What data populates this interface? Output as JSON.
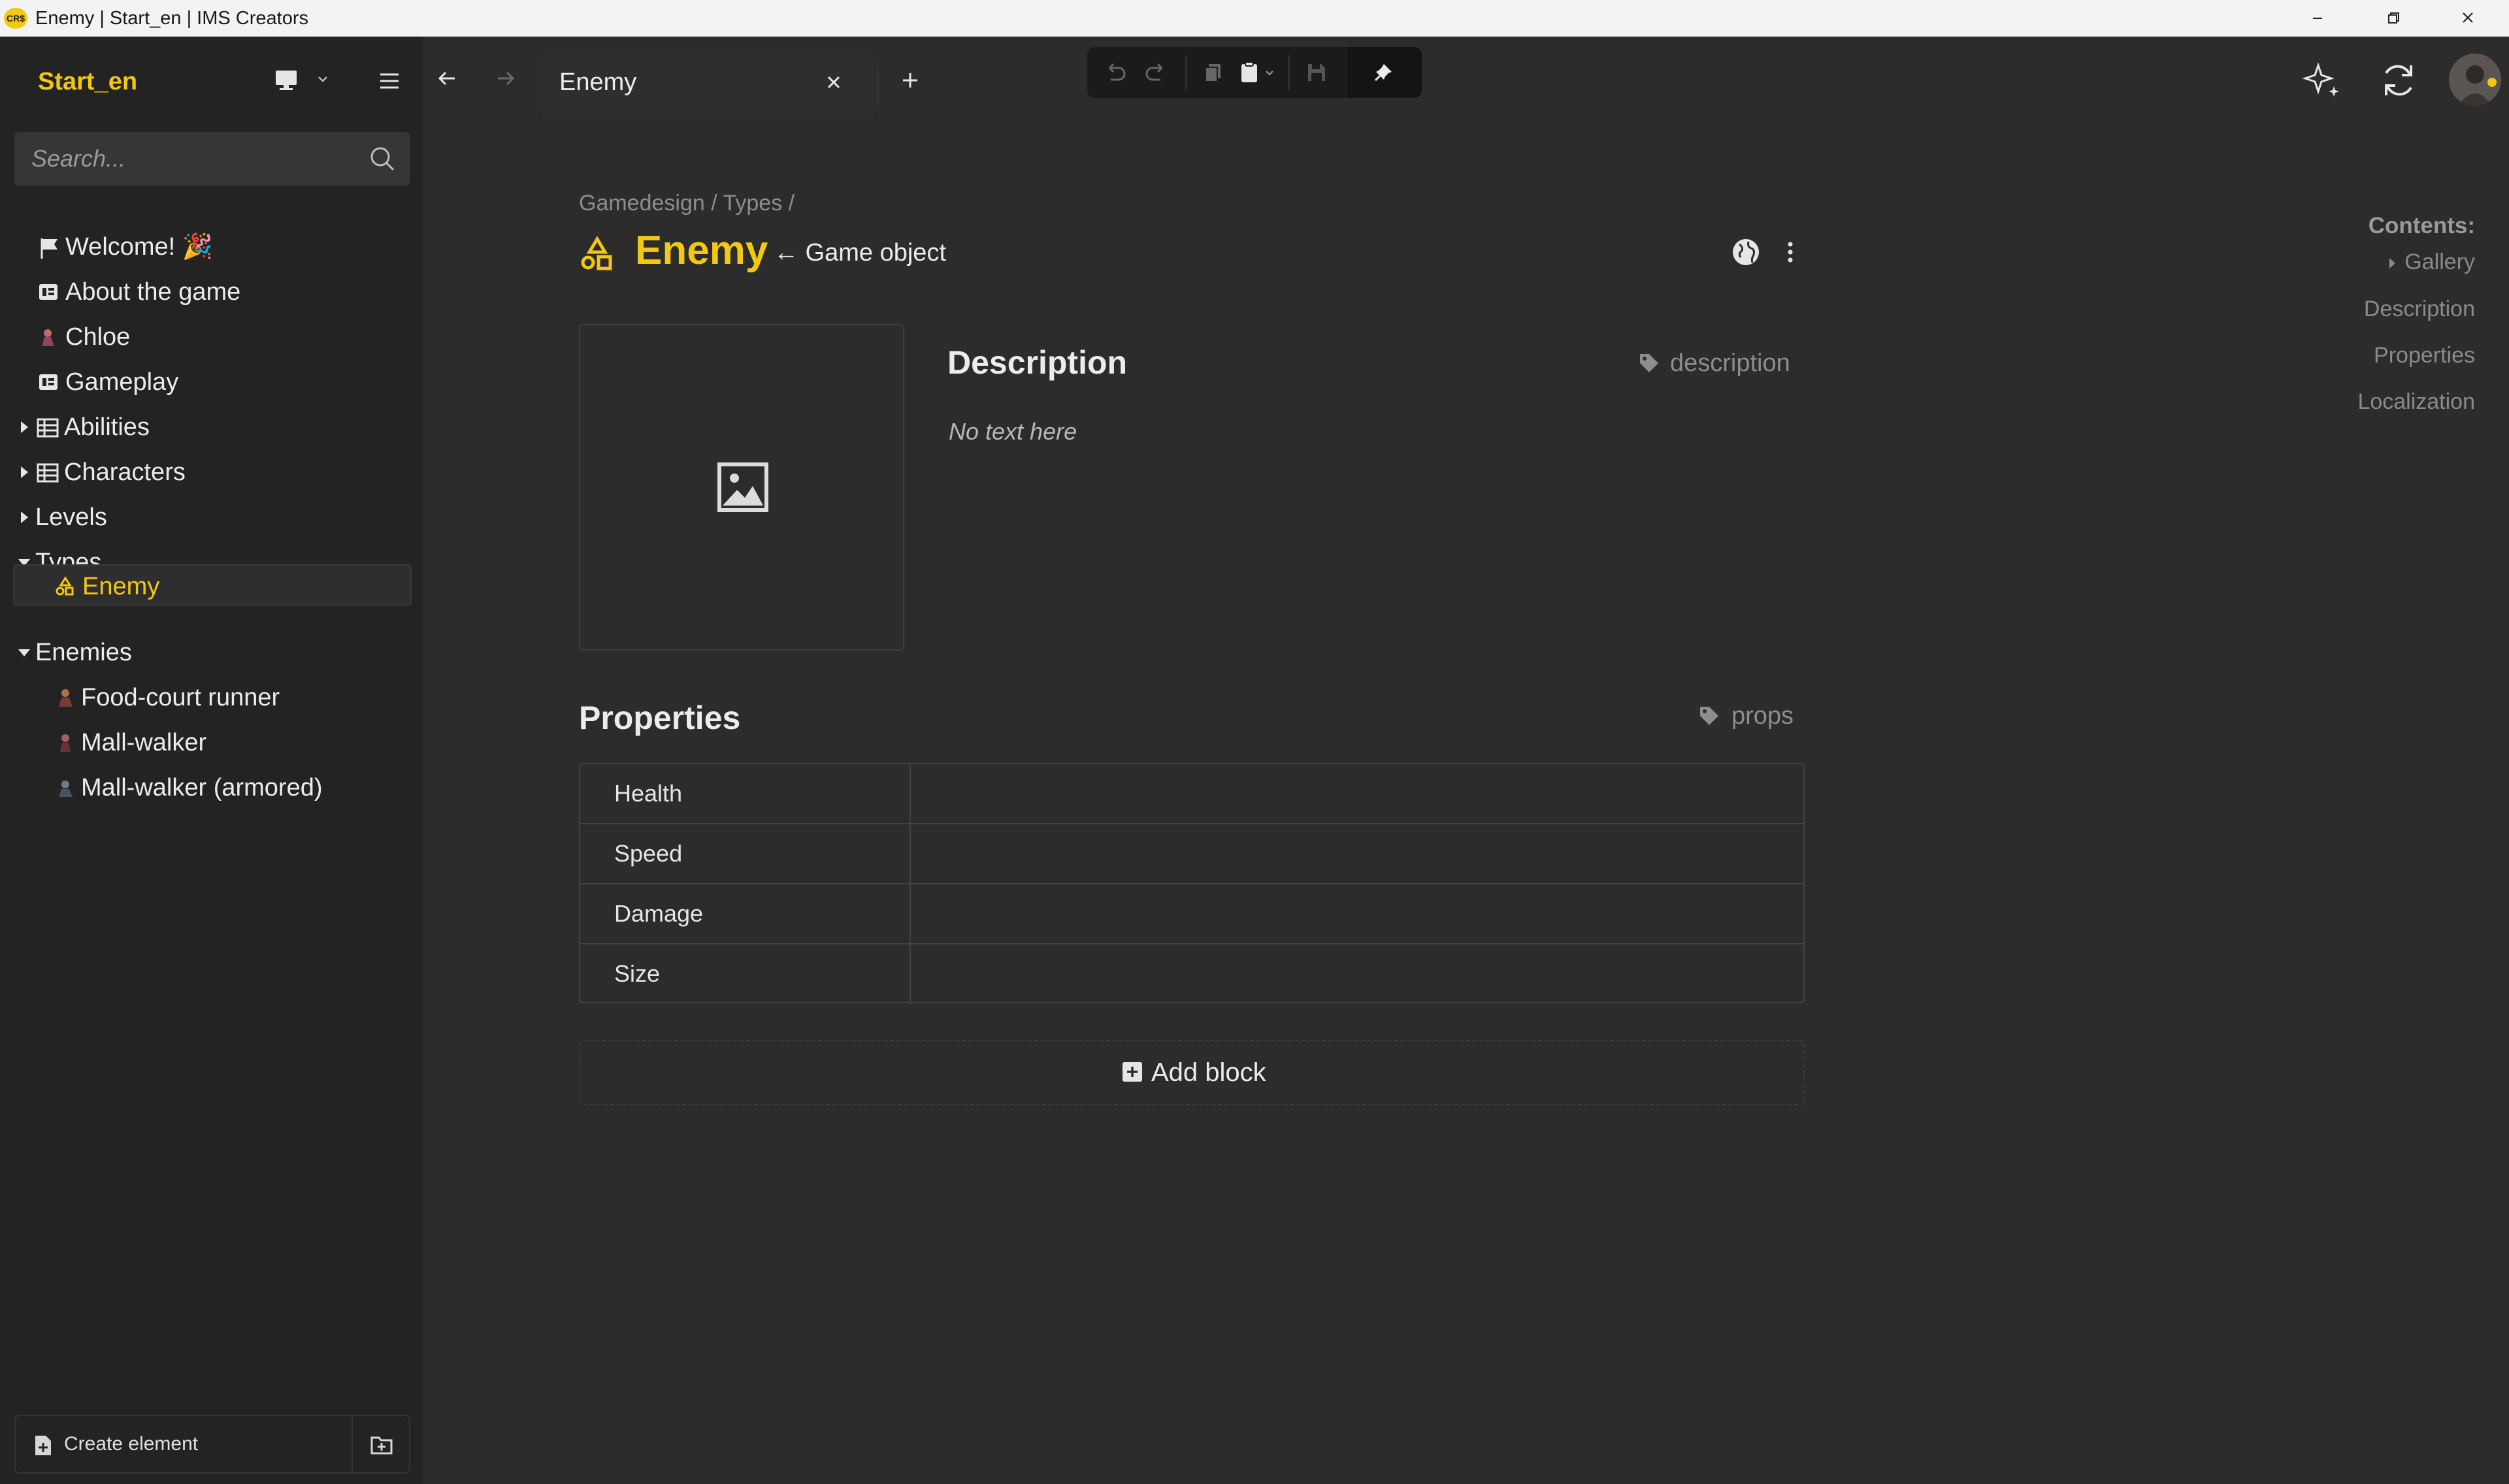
{
  "window": {
    "title": "Enemy | Start_en | IMS Creators",
    "logo_text": "CR$"
  },
  "sidebar": {
    "project_name": "Start_en",
    "search_placeholder": "Search...",
    "tree": [
      {
        "label": "Welcome! 🎉",
        "icon": "flag-icon"
      },
      {
        "label": "About the game",
        "icon": "document-icon"
      },
      {
        "label": "Chloe",
        "icon": "character-avatar-icon"
      },
      {
        "label": "Gameplay",
        "icon": "document-icon"
      },
      {
        "label": "Abilities",
        "icon": "table-icon",
        "expanded": false
      },
      {
        "label": "Characters",
        "icon": "table-icon",
        "expanded": false
      },
      {
        "label": "Levels",
        "expanded": false
      },
      {
        "label": "Types",
        "expanded": true
      },
      {
        "label": "Enemy",
        "icon": "shapes-icon",
        "selected": true
      },
      {
        "label": "Enemies",
        "expanded": true
      },
      {
        "label": "Food-court runner",
        "icon": "character-avatar-icon"
      },
      {
        "label": "Mall-walker",
        "icon": "character-avatar-icon"
      },
      {
        "label": "Mall-walker (armored)",
        "icon": "character-avatar-icon"
      }
    ],
    "create_element_label": "Create element"
  },
  "tabs": [
    {
      "label": "Enemy",
      "active": true
    }
  ],
  "page": {
    "breadcrumb": "Gamedesign / Types /",
    "title": "Enemy",
    "type_link": "← Game object",
    "description": {
      "heading": "Description",
      "tag": "description",
      "empty_text": "No text here"
    },
    "properties": {
      "heading": "Properties",
      "tag": "props",
      "rows": [
        {
          "key": "Health",
          "value": ""
        },
        {
          "key": "Speed",
          "value": ""
        },
        {
          "key": "Damage",
          "value": ""
        },
        {
          "key": "Size",
          "value": ""
        }
      ]
    },
    "add_block_label": "Add block"
  },
  "contents": {
    "title": "Contents:",
    "items": [
      "Gallery",
      "Description",
      "Properties",
      "Localization"
    ]
  },
  "colors": {
    "accent": "#f2c811",
    "background": "#2c2c2c",
    "sidebar": "#232323"
  }
}
